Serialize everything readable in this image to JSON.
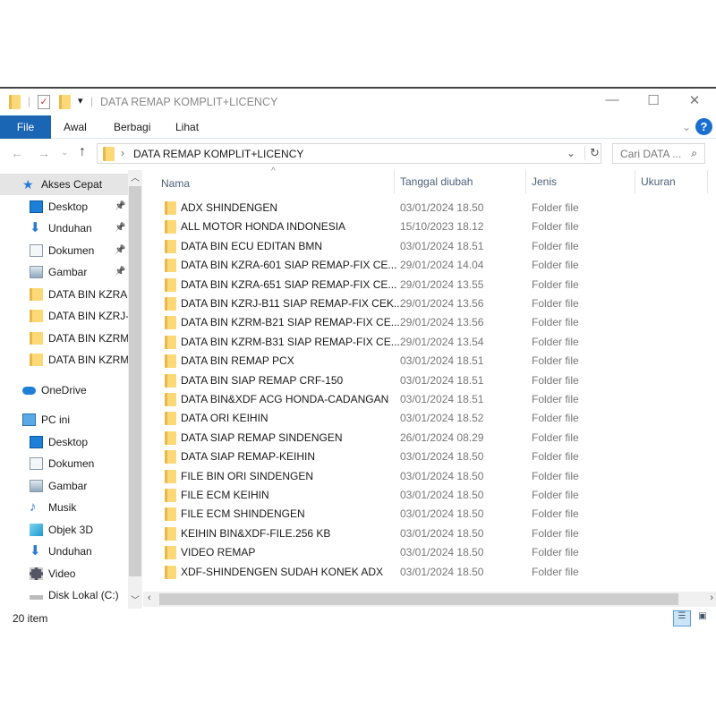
{
  "window": {
    "title": "DATA REMAP KOMPLIT+LICENCY",
    "minimize": "—",
    "maximize": "☐",
    "close": "✕"
  },
  "ribbon": {
    "tabs": [
      "File",
      "Awal",
      "Berbagi",
      "Lihat"
    ],
    "help": "?",
    "expand": "⌄"
  },
  "nav": {
    "back": "←",
    "forward": "→",
    "recent": "⌄",
    "up": "↑",
    "path": "DATA REMAP KOMPLIT+LICENCY",
    "sep": "›",
    "dropdown": "⌄",
    "refresh": "↻",
    "search_placeholder": "Cari DATA ..."
  },
  "sidebar": {
    "items": [
      {
        "label": "Akses Cepat",
        "icon": "star-icon",
        "level": 0,
        "pinned": false,
        "selected": true
      },
      {
        "label": "Desktop",
        "icon": "desktop-icon",
        "level": 1,
        "pinned": true
      },
      {
        "label": "Unduhan",
        "icon": "download-icon",
        "level": 1,
        "pinned": true
      },
      {
        "label": "Dokumen",
        "icon": "document-icon",
        "level": 1,
        "pinned": true
      },
      {
        "label": "Gambar",
        "icon": "picture-icon",
        "level": 1,
        "pinned": true
      },
      {
        "label": "DATA BIN KZRA-",
        "icon": "folder-icon",
        "level": 1
      },
      {
        "label": "DATA BIN KZRJ-B",
        "icon": "folder-icon",
        "level": 1
      },
      {
        "label": "DATA BIN KZRM",
        "icon": "folder-icon",
        "level": 1
      },
      {
        "label": "DATA BIN KZRM",
        "icon": "folder-icon",
        "level": 1
      },
      {
        "label": "OneDrive",
        "icon": "cloud-icon",
        "level": 0,
        "gap": true
      },
      {
        "label": "PC ini",
        "icon": "computer-icon",
        "level": 0,
        "gap": true
      },
      {
        "label": "Desktop",
        "icon": "desktop-icon",
        "level": 1
      },
      {
        "label": "Dokumen",
        "icon": "document-icon",
        "level": 1
      },
      {
        "label": "Gambar",
        "icon": "picture-icon",
        "level": 1
      },
      {
        "label": "Musik",
        "icon": "music-icon",
        "level": 1
      },
      {
        "label": "Objek 3D",
        "icon": "cube-icon",
        "level": 1
      },
      {
        "label": "Unduhan",
        "icon": "download-icon",
        "level": 1
      },
      {
        "label": "Video",
        "icon": "video-icon",
        "level": 1
      },
      {
        "label": "Disk Lokal (C:)",
        "icon": "disk-icon",
        "level": 1
      }
    ]
  },
  "columns": {
    "name": "Nama",
    "date": "Tanggal diubah",
    "type": "Jenis",
    "size": "Ukuran"
  },
  "files": [
    {
      "name": "ADX SHINDENGEN",
      "date": "03/01/2024 18.50",
      "type": "Folder file"
    },
    {
      "name": "ALL MOTOR HONDA INDONESIA",
      "date": "15/10/2023 18.12",
      "type": "Folder file"
    },
    {
      "name": "DATA BIN ECU EDITAN BMN",
      "date": "03/01/2024 18.51",
      "type": "Folder file"
    },
    {
      "name": "DATA BIN KZRA-601 SIAP REMAP-FIX CE...",
      "date": "29/01/2024 14.04",
      "type": "Folder file"
    },
    {
      "name": "DATA BIN KZRA-651 SIAP REMAP-FIX CE...",
      "date": "29/01/2024 13.55",
      "type": "Folder file"
    },
    {
      "name": "DATA BIN KZRJ-B11 SIAP REMAP-FIX CEK...",
      "date": "29/01/2024 13.56",
      "type": "Folder file"
    },
    {
      "name": "DATA BIN KZRM-B21 SIAP REMAP-FIX CE...",
      "date": "29/01/2024 13.56",
      "type": "Folder file"
    },
    {
      "name": "DATA BIN KZRM-B31 SIAP REMAP-FIX CE...",
      "date": "29/01/2024 13.54",
      "type": "Folder file"
    },
    {
      "name": "DATA BIN REMAP PCX",
      "date": "03/01/2024 18.51",
      "type": "Folder file"
    },
    {
      "name": "DATA BIN SIAP REMAP CRF-150",
      "date": "03/01/2024 18.51",
      "type": "Folder file"
    },
    {
      "name": "DATA BIN&XDF ACG HONDA-CADANGAN",
      "date": "03/01/2024 18.51",
      "type": "Folder file"
    },
    {
      "name": "DATA ORI KEIHIN",
      "date": "03/01/2024 18.52",
      "type": "Folder file"
    },
    {
      "name": "DATA SIAP REMAP SINDENGEN",
      "date": "26/01/2024 08.29",
      "type": "Folder file"
    },
    {
      "name": "DATA SIAP REMAP-KEIHIN",
      "date": "03/01/2024 18.50",
      "type": "Folder file"
    },
    {
      "name": "FILE BIN ORI  SINDENGEN",
      "date": "03/01/2024 18.50",
      "type": "Folder file"
    },
    {
      "name": "FILE ECM KEIHIN",
      "date": "03/01/2024 18.50",
      "type": "Folder file"
    },
    {
      "name": "FILE ECM SHINDENGEN",
      "date": "03/01/2024 18.50",
      "type": "Folder file"
    },
    {
      "name": "KEIHIN BIN&XDF-FILE.256 KB",
      "date": "03/01/2024 18.50",
      "type": "Folder file"
    },
    {
      "name": "VIDEO REMAP",
      "date": "03/01/2024 18.50",
      "type": "Folder file"
    },
    {
      "name": "XDF-SHINDENGEN SUDAH KONEK ADX",
      "date": "03/01/2024 18.50",
      "type": "Folder file"
    }
  ],
  "status": {
    "count": "20 item"
  },
  "colors": {
    "accent": "#1a66b5",
    "folder": "#fcd876",
    "selected": "#e5e5e5"
  }
}
